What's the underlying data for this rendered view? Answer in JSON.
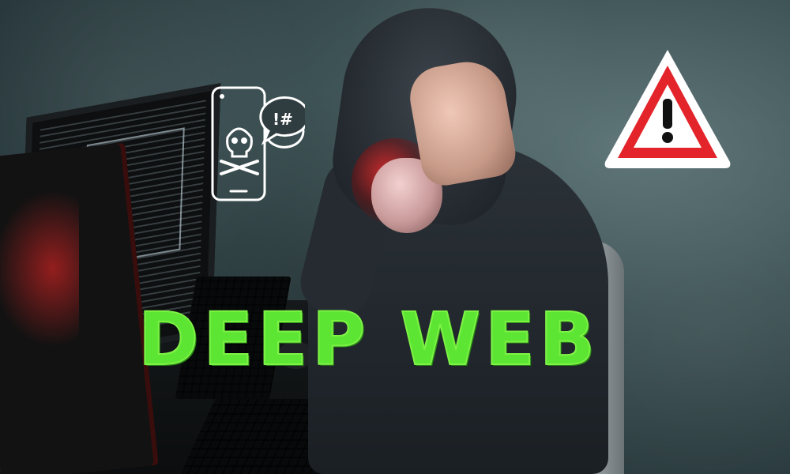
{
  "title": "DEEP WEB",
  "icons": {
    "phone": "phone-skull-icon",
    "speech": "speech-bubble-icon",
    "speech_text": "!#",
    "warning": "warning-triangle-icon"
  },
  "colors": {
    "title": "#5de534",
    "warning_red": "#e3242b",
    "accent_red": "#ff2a2a"
  }
}
